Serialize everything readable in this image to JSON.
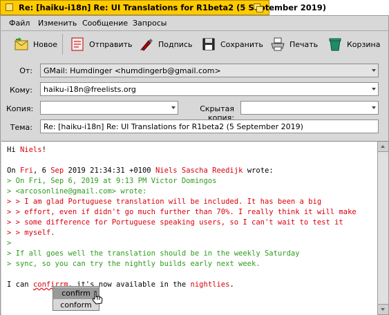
{
  "window": {
    "title": "Re: [haiku-i18n] Re: UI Translations for R1beta2 (5 September 2019)"
  },
  "menubar": {
    "items": [
      "Файл",
      "Изменить",
      "Сообщение",
      "Запросы"
    ]
  },
  "toolbar": {
    "new_label": "Новое",
    "send_label": "Отправить",
    "sign_label": "Подпись",
    "save_label": "Сохранить",
    "print_label": "Печать",
    "trash_label": "Корзина"
  },
  "header": {
    "from_label": "От:",
    "from_value": "GMail:  Humdinger <humdingerb@gmail.com>",
    "to_label": "Кому:",
    "to_value": "haiku-i18n@freelists.org",
    "cc_label": "Копия:",
    "cc_value": "",
    "bcc_label": "Скрытая копия:",
    "bcc_value": "",
    "subject_label": "Тема:",
    "subject_value": "Re: [haiku-i18n] Re: UI Translations for R1beta2 (5 September 2019)"
  },
  "body": {
    "greet_pre": "Hi ",
    "greet_name": "Niels",
    "greet_post": "!",
    "attr_on": "On ",
    "attr_date_a": "Fri",
    "attr_date_b": ", 6 ",
    "attr_date_c": "Sep",
    "attr_date_d": " 2019 21:34:31 +0100 ",
    "attr_name": "Niels Sascha Reedijk",
    "attr_wrote": " wrote:",
    "q1_line1": "> On Fri, Sep 6, 2019 at 9:13 PM Victor Domingos",
    "q1_line2": "> <arcosonline@gmail.com> wrote:",
    "q2_line1": "> > I am glad Portuguese translation will be included. It has been a big",
    "q2_line2": "> > effort, even if didn't go much further than 70%. I really think it will make",
    "q2_line3": "> > some difference for Portuguese speaking users, so I can't wait to test it",
    "q2_line4": "> > myself.",
    "q_blank": ">",
    "q3_line1": "> If all goes well the translation should be in the weekly Saturday",
    "q3_line2": "> sync, so you can try the nightly builds early next week.",
    "last_pre": "I can ",
    "last_word": "confirrm",
    "last_mid": ", it's now available in the ",
    "last_word2": "nightlies",
    "last_post": "."
  },
  "spell_popup": {
    "items": [
      "confirm",
      "conform"
    ]
  },
  "colors": {
    "titlebar": "#ffcb00",
    "quote_level1": "#d8000c",
    "quote_level2": "#2c9c1c"
  }
}
